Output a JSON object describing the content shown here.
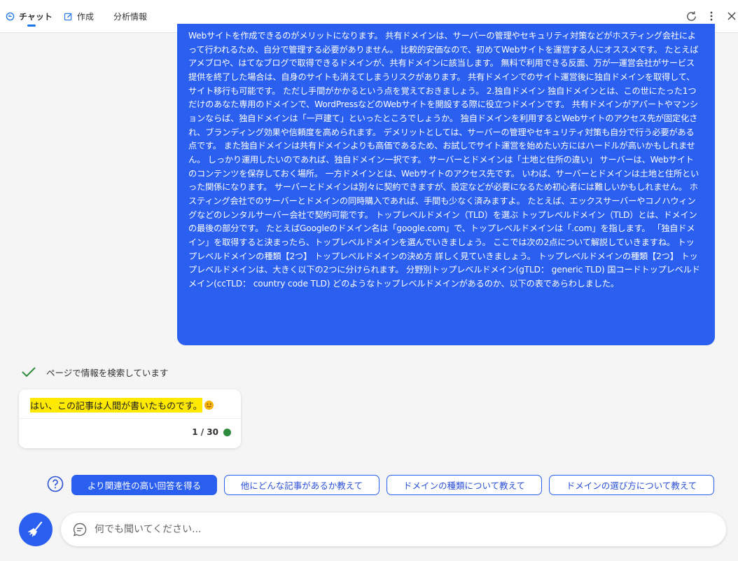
{
  "tabs": [
    {
      "label": "チャット",
      "icon": "chat-icon",
      "active": true
    },
    {
      "label": "作成",
      "icon": "compose-icon",
      "active": false
    },
    {
      "label": "分析情報",
      "icon": "",
      "active": false
    }
  ],
  "toolbar_icons": [
    "refresh-icon",
    "more-icon",
    "close-icon"
  ],
  "user_message": "Webサイトを作成できるのがメリットになります。 共有ドメインは、サーバーの管理やセキュリティ対策などがホスティング会社によって行われるため、自分で管理する必要がありません。 比較的安価なので、初めてWebサイトを運営する人にオススメです。 たとえばアメブロや、はてなブログで取得できるドメインが、共有ドメインに該当します。 無料で利用できる反面、万が一運営会社がサービス提供を終了した場合は、自身のサイトも消えてしまうリスクがあります。 共有ドメインでのサイト運営後に独自ドメインを取得して、サイト移行も可能です。 ただし手間がかかるという点を覚えておきましょう。 2.独自ドメイン 独自ドメインとは、この世にたった1つだけのあなた専用のドメインで、WordPressなどのWebサイトを開設する際に役立つドメインです。 共有ドメインがアパートやマンションならば、独自ドメインは「一戸建て」といったところでしょうか。 独自ドメインを利用するとWebサイトのアクセス先が固定化され、ブランディング効果や信頼度を高められます。 デメリットとしては、サーバーの管理やセキュリティ対策も自分で行う必要がある点です。 また独自ドメインは共有ドメインよりも高価であるため、お試しでサイト運営を始めたい方にはハードルが高いかもしれません。 しっかり運用したいのであれば、独自ドメイン一択です。 サーバーとドメインは「土地と住所の違い」 サーバーは、Webサイトのコンテンツを保存しておく場所。 一方ドメインとは、Webサイトのアクセス先です。 いわば、サーバーとドメインは土地と住所といった関係になります。 サーバーとドメインは別々に契約できますが、設定などが必要になるため初心者には難しいかもしれません。 ホスティング会社でのサーバーとドメインの同時購入であれば、手間も少なく済みますよ。 たとえば、エックスサーバーやコノハウィングなどのレンタルサーバー会社で契約可能です。 トップレベルドメイン（TLD）を選ぶ トップレベルドメイン（TLD）とは、ドメインの最後の部分です。 たとえばGoogleのドメイン名は「google.com」で、トップレベルドメインは「.com」を指します。 「独自ドメイン」を取得すると決まったら、トップレベルドメインを選んでいきましょう。 ここでは次の2点について解説していきますね。 トップレベルドメインの種類【2つ】 トップレベルドメインの決め方 詳しく見ていきましょう。 トップレベルドメインの種類【2つ】 トップレベルドメインは、大きく以下の2つに分けられます。 分野別トップレベルドメイン(gTLD： generic TLD) 国コードトップレベルドメイン(ccTLD： country code TLD) どのようなトップレベルドメインがあるのか、以下の表であらわしました。",
  "search_status": "ページで情報を検索しています",
  "bot_answer": "はい、この記事は人間が書いたものです。",
  "response_counter": "1 / 30",
  "suggestions": [
    "より関連性の高い回答を得る",
    "他にどんな記事があるか教えて",
    "ドメインの種類について教えて",
    "ドメインの選び方について教えて"
  ],
  "input_placeholder": "何でも聞いてください...",
  "colors": {
    "accent": "#2a5ff0",
    "highlight": "#ffe900",
    "status_dot": "#2e8b3e",
    "check": "#2e8b3e"
  }
}
